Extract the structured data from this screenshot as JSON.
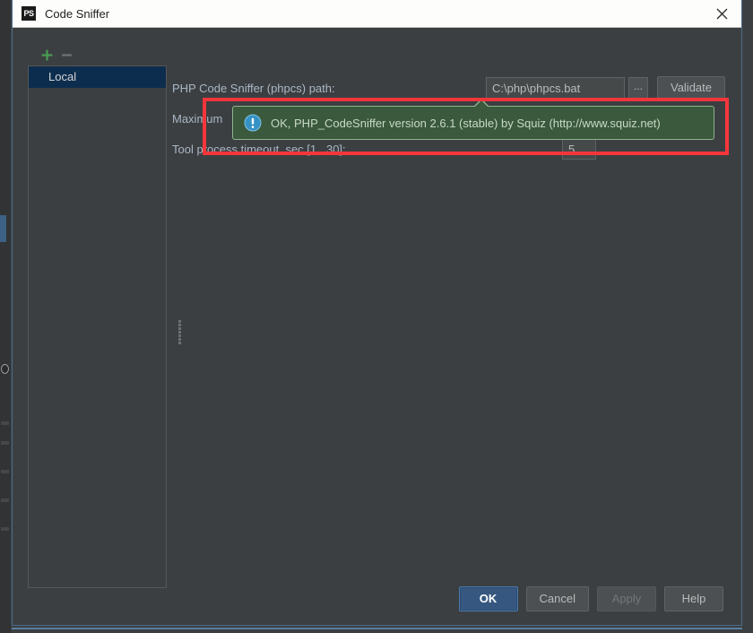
{
  "window": {
    "title": "Code Sniffer",
    "app_icon": "PS",
    "close_icon": "close-icon"
  },
  "left_pane": {
    "add_label": "+",
    "remove_label": "–",
    "items": [
      {
        "label": "Local",
        "selected": true
      }
    ]
  },
  "settings": {
    "path_row": {
      "label": "PHP Code Sniffer (phpcs) path:",
      "value": "C:\\php\\phpcs.bat",
      "placeholder": "",
      "browse_label": "...",
      "validate_label": "Validate"
    },
    "max_row": {
      "label": "Maximum",
      "value": ""
    },
    "timeout_row": {
      "label": "Tool process timeout, sec [1...30]:",
      "value": "5",
      "placeholder": ""
    }
  },
  "balloon": {
    "icon": "info-circle-icon",
    "message": "OK, PHP_CodeSniffer version 2.6.1 (stable) by Squiz (http://www.squiz.net)"
  },
  "footer": {
    "ok_label": "OK",
    "cancel_label": "Cancel",
    "apply_label": "Apply",
    "help_label": "Help"
  },
  "colors": {
    "dialog_bg": "#3c3f41",
    "titlebar_bg": "#fdfdfb",
    "label_text": "#a9b7c6",
    "selection_bg": "#0d2d4e",
    "primary_button": "#365880",
    "balloon_bg": "#3b593d",
    "balloon_border": "#8fb28f",
    "highlight_red": "#f4363b",
    "add_icon_green": "#499c54",
    "info_icon_blue": "#3592c4",
    "window_border": "#4a6c8c"
  }
}
